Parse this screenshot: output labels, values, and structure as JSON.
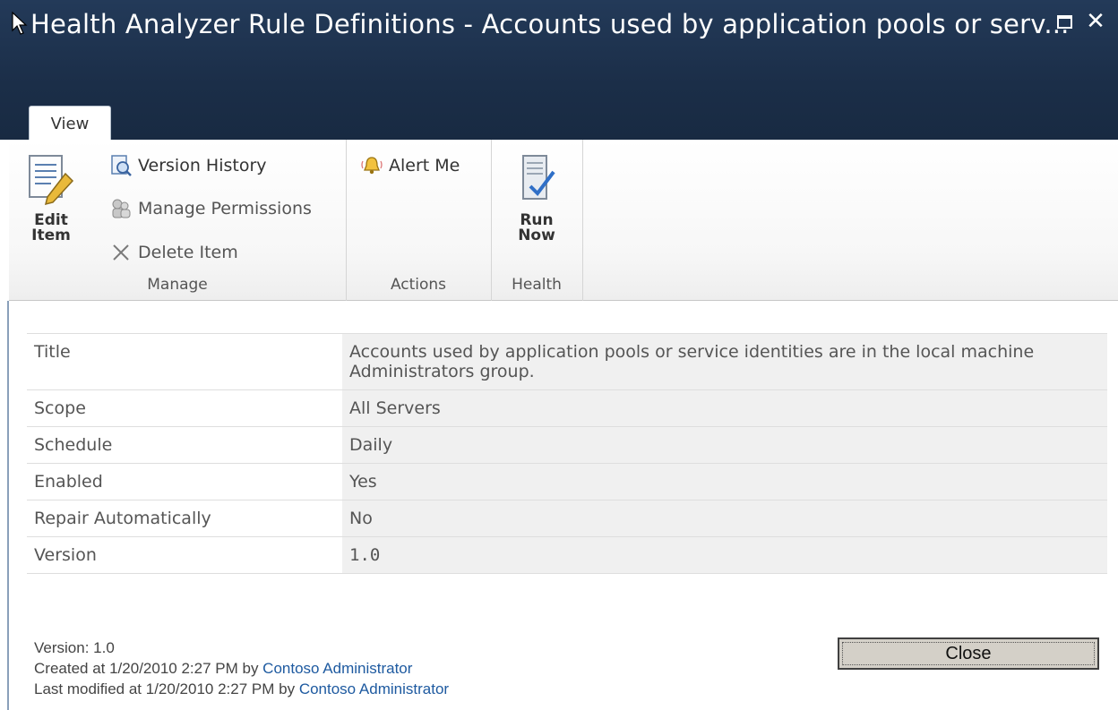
{
  "window": {
    "title": "Health Analyzer Rule Definitions - Accounts used by application pools or serv...",
    "maximize_icon": "maximize-icon",
    "close_icon": "close-icon"
  },
  "ribbon": {
    "tabs": [
      {
        "label": "View",
        "selected": true
      }
    ],
    "groups": {
      "manage": {
        "label": "Manage",
        "edit_item": "Edit Item",
        "version_history": "Version History",
        "manage_permissions": "Manage Permissions",
        "delete_item": "Delete Item"
      },
      "actions": {
        "label": "Actions",
        "alert_me": "Alert Me"
      },
      "health": {
        "label": "Health",
        "run_now": "Run Now"
      }
    }
  },
  "properties": [
    {
      "label": "Title",
      "value": "Accounts used by application pools or service identities are in the local machine Administrators group."
    },
    {
      "label": "Scope",
      "value": "All Servers"
    },
    {
      "label": "Schedule",
      "value": "Daily"
    },
    {
      "label": "Enabled",
      "value": "Yes"
    },
    {
      "label": "Repair Automatically",
      "value": "No"
    },
    {
      "label": "Version",
      "value": "1.0"
    }
  ],
  "footer": {
    "version_line": "Version: 1.0",
    "created_prefix": "Created at 1/20/2010 2:27 PM by ",
    "created_by": "Contoso Administrator",
    "modified_prefix": "Last modified at 1/20/2010 2:27 PM by ",
    "modified_by": "Contoso Administrator"
  },
  "close_button": "Close",
  "colors": {
    "title_bar": "#1c2f4a",
    "link": "#1e5aa0",
    "value_cell_bg": "#f0f0f0"
  }
}
